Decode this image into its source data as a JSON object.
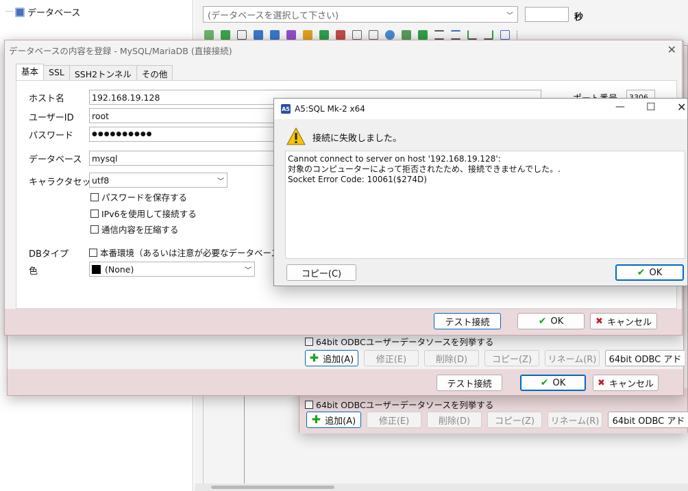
{
  "app": {
    "tree_root": "データベース",
    "db_combo_placeholder": "(データベースを選択して下さい)",
    "seconds_label": "秒"
  },
  "dialog_back2": {
    "odbc_checkbox": "64bit ODBCユーザーデータソースを列挙する",
    "add": "追加(A)",
    "edit": "修正(E)",
    "delete": "削除(D)",
    "copy": "コピー(Z)",
    "rename": "リネーム(R)",
    "odbc_admin": "64bit ODBC アド"
  },
  "dialog_back1": {
    "test": "テスト接続",
    "ok": "OK",
    "cancel": "キャンセル",
    "odbc_checkbox": "64bit ODBCユーザーデータソースを列挙する",
    "add": "追加(A)",
    "edit": "修正(E)",
    "delete": "削除(D)",
    "copy": "コピー(Z)",
    "rename": "リネーム(R)",
    "odbc_admin": "64bit ODBC アド"
  },
  "register": {
    "title": "データベースの内容を登録 - MySQL/MariaDB (直接接続)",
    "tabs": [
      "基本",
      "SSL",
      "SSH2トンネル",
      "その他"
    ],
    "host_label": "ホスト名",
    "host_value": "192.168.19.128",
    "port_label": "ポート番号",
    "port_value": "3306",
    "user_label": "ユーザーID",
    "user_value": "root",
    "password_label": "パスワード",
    "password_value": "●●●●●●●●●●",
    "database_label": "データベース",
    "database_value": "mysql",
    "charset_label": "キャラクタセット",
    "charset_value": "utf8",
    "save_password": "パスワードを保存する",
    "use_ipv6": "IPv6を使用して接続する",
    "compress": "通信内容を圧縮する",
    "dbtype_label": "DBタイプ",
    "production": "本番環境（あるいは注意が必要なデータベース）",
    "color_label": "色",
    "color_value": "(None)",
    "test": "テスト接続",
    "ok": "OK",
    "cancel": "キャンセル"
  },
  "msgbox": {
    "title": "A5:SQL Mk-2 x64",
    "heading": "接続に失敗しました。",
    "message": "Cannot connect to server on host '192.168.19.128':\n対象のコンピューターによって拒否されたため、接続できませんでした。.\nSocket Error Code: 10061($274D)",
    "copy": "コピー(C)",
    "ok": "OK"
  }
}
